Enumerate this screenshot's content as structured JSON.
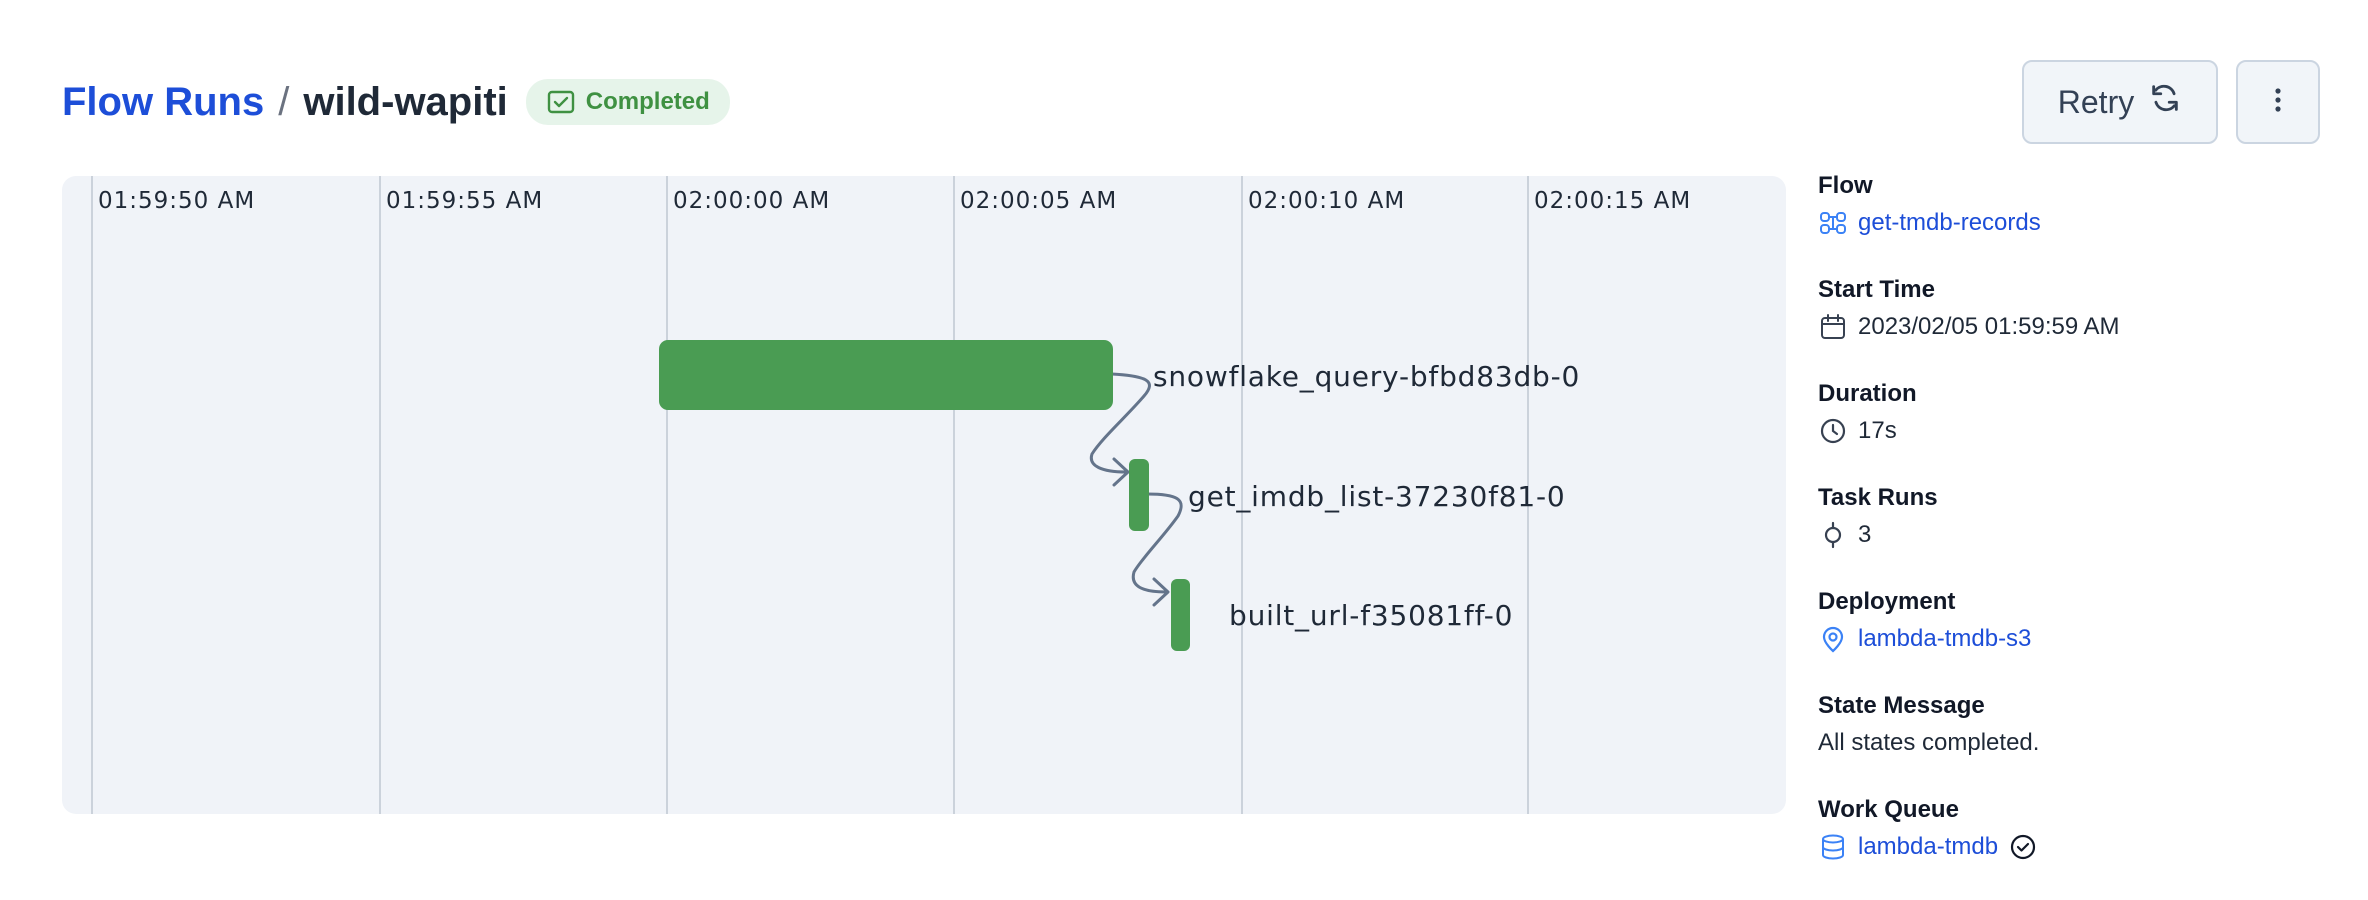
{
  "breadcrumb": {
    "parent": "Flow Runs",
    "separator": "/",
    "current": "wild-wapiti"
  },
  "status": {
    "label": "Completed",
    "color": "#3f9142",
    "background": "#e6f4ea"
  },
  "actions": {
    "retry_label": "Retry",
    "retry_icon": "refresh-icon",
    "more_icon": "vertical-dots-icon"
  },
  "timeline": {
    "ticks": [
      "01:59:50 AM",
      "01:59:55 AM",
      "02:00:00 AM",
      "02:00:05 AM",
      "02:00:10 AM",
      "02:00:15 AM"
    ],
    "tasks": [
      {
        "label": "snowflake_query-bfbd83db-0",
        "state": "Completed"
      },
      {
        "label": "get_imdb_list-37230f81-0",
        "state": "Completed"
      },
      {
        "label": "built_url-f35081ff-0",
        "state": "Completed"
      }
    ],
    "bar_color": "#4a9c53",
    "edge_color": "#64748b"
  },
  "details": {
    "flow": {
      "label": "Flow",
      "value": "get-tmdb-records",
      "icon": "flow-icon"
    },
    "start_time": {
      "label": "Start Time",
      "value": "2023/02/05 01:59:59 AM",
      "icon": "calendar-icon"
    },
    "duration": {
      "label": "Duration",
      "value": "17s",
      "icon": "clock-icon"
    },
    "task_runs": {
      "label": "Task Runs",
      "value": "3",
      "icon": "task-icon"
    },
    "deployment": {
      "label": "Deployment",
      "value": "lambda-tmdb-s3",
      "icon": "location-pin-icon"
    },
    "state_message": {
      "label": "State Message",
      "value": "All states completed."
    },
    "work_queue": {
      "label": "Work Queue",
      "value": "lambda-tmdb",
      "icon": "database-icon",
      "status_icon": "check-circle-icon"
    }
  }
}
